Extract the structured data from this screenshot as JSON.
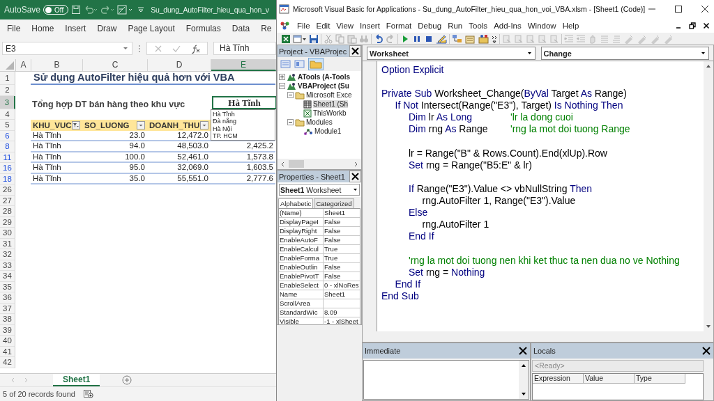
{
  "excel": {
    "autosave": {
      "label": "AutoSave",
      "state": "Off",
      "on": false
    },
    "title": "Su_dung_AutoFilter_hieu_qua_hon_v",
    "ribbon_tabs": [
      "File",
      "Home",
      "Insert",
      "Draw",
      "Page Layout",
      "Formulas",
      "Data",
      "Re"
    ],
    "name_box": "E3",
    "formula": "Hà Tĩnh",
    "columns": [
      {
        "label": "A",
        "selected": false
      },
      {
        "label": "B",
        "selected": false
      },
      {
        "label": "C",
        "selected": false
      },
      {
        "label": "D",
        "selected": false
      },
      {
        "label": "E",
        "selected": true
      }
    ],
    "rows": [
      {
        "number": "1",
        "filtered": false,
        "selected": false,
        "kind": "title",
        "text": "Sử dụng AutoFilter hiệu quả hơn với VBA"
      },
      {
        "number": "2",
        "filtered": false,
        "selected": false,
        "kind": "blank"
      },
      {
        "number": "3",
        "filtered": false,
        "selected": true,
        "kind": "subtitle",
        "text": "Tổng hợp DT bán hàng theo khu vực",
        "cell": "Hà Tĩnh"
      },
      {
        "number": "4",
        "filtered": false,
        "selected": false,
        "kind": "blank"
      },
      {
        "number": "5",
        "filtered": false,
        "selected": false,
        "kind": "header",
        "cells": [
          {
            "label": "KHU_VUC",
            "filter_active": true
          },
          {
            "label": "SO_LUONG",
            "filter_active": false
          },
          {
            "label": "DOANH_THU",
            "filter_active": false
          }
        ]
      },
      {
        "number": "6",
        "filtered": true,
        "selected": false,
        "kind": "data",
        "cells": [
          "Hà Tĩnh",
          "23.0",
          "12,472.0"
        ]
      },
      {
        "number": "8",
        "filtered": true,
        "selected": false,
        "kind": "data",
        "cells": [
          "Hà Tĩnh",
          "94.0",
          "48,503.0",
          "2,425.2"
        ]
      },
      {
        "number": "11",
        "filtered": true,
        "selected": false,
        "kind": "data",
        "cells": [
          "Hà Tĩnh",
          "100.0",
          "52,461.0",
          "1,573.8"
        ]
      },
      {
        "number": "16",
        "filtered": true,
        "selected": false,
        "kind": "data",
        "cells": [
          "Hà Tĩnh",
          "95.0",
          "32,069.0",
          "1,603.5"
        ]
      },
      {
        "number": "18",
        "filtered": true,
        "selected": false,
        "kind": "data",
        "cells": [
          "Hà Tĩnh",
          "35.0",
          "55,551.0",
          "2,777.6"
        ]
      },
      {
        "number": "26",
        "filtered": false,
        "selected": false,
        "kind": "blank"
      },
      {
        "number": "27",
        "filtered": false,
        "selected": false,
        "kind": "blank"
      },
      {
        "number": "28",
        "filtered": false,
        "selected": false,
        "kind": "blank"
      },
      {
        "number": "29",
        "filtered": false,
        "selected": false,
        "kind": "blank"
      },
      {
        "number": "30",
        "filtered": false,
        "selected": false,
        "kind": "blank"
      },
      {
        "number": "31",
        "filtered": false,
        "selected": false,
        "kind": "blank"
      },
      {
        "number": "32",
        "filtered": false,
        "selected": false,
        "kind": "blank"
      },
      {
        "number": "33",
        "filtered": false,
        "selected": false,
        "kind": "blank"
      },
      {
        "number": "34",
        "filtered": false,
        "selected": false,
        "kind": "blank"
      },
      {
        "number": "35",
        "filtered": false,
        "selected": false,
        "kind": "blank"
      },
      {
        "number": "36",
        "filtered": false,
        "selected": false,
        "kind": "blank"
      },
      {
        "number": "37",
        "filtered": false,
        "selected": false,
        "kind": "blank"
      },
      {
        "number": "38",
        "filtered": false,
        "selected": false,
        "kind": "blank"
      },
      {
        "number": "39",
        "filtered": false,
        "selected": false,
        "kind": "blank"
      },
      {
        "number": "40",
        "filtered": false,
        "selected": false,
        "kind": "blank"
      },
      {
        "number": "41",
        "filtered": false,
        "selected": false,
        "kind": "blank"
      },
      {
        "number": "42",
        "filtered": false,
        "selected": false,
        "kind": "blank"
      }
    ],
    "dropdown_list": [
      "Hà Tĩnh",
      "Đà nẵng",
      "Hà Nội",
      "TP. HCM"
    ],
    "sheet_tabs": [
      {
        "label": "Sheet1",
        "selected": true
      }
    ],
    "status": "5 of 20 records found"
  },
  "vba": {
    "title": "Microsoft Visual Basic for Applications - Su_dung_AutoFilter_hieu_qua_hon_voi_VBA.xlsm - [Sheet1 (Code)]",
    "menu": [
      "File",
      "Edit",
      "View",
      "Insert",
      "Format",
      "Debug",
      "Run",
      "Tools",
      "Add-Ins",
      "Window",
      "Help"
    ],
    "project": {
      "title": "Project - VBAProjec",
      "tree": [
        {
          "label": "ATools (A-Tools",
          "kind": "project",
          "expanded": false,
          "selected": false
        },
        {
          "label": "VBAProject (Su",
          "kind": "project",
          "expanded": true,
          "selected": false,
          "children": [
            {
              "label": "Microsoft Exce",
              "kind": "folder",
              "expanded": true,
              "selected": false,
              "children": [
                {
                  "label": "Sheet1 (Sh",
                  "kind": "sheet",
                  "selected": true
                },
                {
                  "label": "ThisWorkb",
                  "kind": "workbook",
                  "selected": false
                }
              ]
            },
            {
              "label": "Modules",
              "kind": "folder",
              "expanded": true,
              "selected": false,
              "children": [
                {
                  "label": "Module1",
                  "kind": "module",
                  "selected": false
                }
              ]
            }
          ]
        }
      ]
    },
    "properties": {
      "title": "Properties - Sheet1",
      "object": "Sheet1",
      "object_type": "Worksheet",
      "tabs": [
        {
          "label": "Alphabetic",
          "selected": true
        },
        {
          "label": "Categorized",
          "selected": false
        }
      ],
      "rows": [
        {
          "name": "(Name)",
          "value": "Sheet1"
        },
        {
          "name": "DisplayPageI",
          "value": "False"
        },
        {
          "name": "DisplayRight",
          "value": "False"
        },
        {
          "name": "EnableAutoF",
          "value": "False"
        },
        {
          "name": "EnableCalcul",
          "value": "True"
        },
        {
          "name": "EnableForma",
          "value": "True"
        },
        {
          "name": "EnableOutlin",
          "value": "False"
        },
        {
          "name": "EnablePivotT",
          "value": "False"
        },
        {
          "name": "EnableSelect",
          "value": "0 - xlNoRes"
        },
        {
          "name": "Name",
          "value": "Sheet1"
        },
        {
          "name": "ScrollArea"
        },
        {
          "name": "StandardWic",
          "value": "8.09"
        },
        {
          "name": "Visible",
          "value": "-1 - xlSheet"
        }
      ]
    },
    "code": {
      "object": "Worksheet",
      "procedure": "Change",
      "lines": [
        {
          "kind": "code",
          "tokens": [
            {
              "kind": "keyword",
              "text": "Option Explicit"
            }
          ]
        },
        {
          "kind": "blank"
        },
        {
          "kind": "code",
          "tokens": [
            {
              "kind": "keyword",
              "text": "Private Sub"
            },
            {
              "kind": "plain",
              "text": " Worksheet_Change("
            },
            {
              "kind": "keyword",
              "text": "ByVal"
            },
            {
              "kind": "plain",
              "text": " Target "
            },
            {
              "kind": "keyword",
              "text": "As"
            },
            {
              "kind": "plain",
              "text": " Range)"
            }
          ],
          "children": [
            {
              "kind": "code",
              "tokens": [
                {
                  "kind": "keyword",
                  "text": "If Not"
                },
                {
                  "kind": "plain",
                  "text": " Intersect(Range(\"E3\"), Target) "
                },
                {
                  "kind": "keyword",
                  "text": "Is Nothing Then"
                }
              ],
              "children": [
                {
                  "kind": "code",
                  "tokens": [
                    {
                      "kind": "keyword",
                      "text": "Dim"
                    },
                    {
                      "kind": "plain",
                      "text": " lr "
                    },
                    {
                      "kind": "keyword",
                      "text": "As Long"
                    },
                    {
                      "kind": "comment",
                      "text": "'lr la dong cuoi"
                    }
                  ]
                },
                {
                  "kind": "code",
                  "tokens": [
                    {
                      "kind": "keyword",
                      "text": "Dim"
                    },
                    {
                      "kind": "plain",
                      "text": " rng "
                    },
                    {
                      "kind": "keyword",
                      "text": "As"
                    },
                    {
                      "kind": "plain",
                      "text": " Range"
                    },
                    {
                      "kind": "comment",
                      "text": "'rng la mot doi tuong Range"
                    }
                  ]
                },
                {
                  "kind": "blank"
                },
                {
                  "kind": "code",
                  "tokens": [
                    {
                      "kind": "plain",
                      "text": "lr = Range(\"B\" & Rows.Count).End(xlUp).Row"
                    }
                  ]
                },
                {
                  "kind": "code",
                  "tokens": [
                    {
                      "kind": "keyword",
                      "text": "Set"
                    },
                    {
                      "kind": "plain",
                      "text": " rng = Range(\"B5:E\" & lr)"
                    }
                  ]
                },
                {
                  "kind": "blank"
                },
                {
                  "kind": "code",
                  "tokens": [
                    {
                      "kind": "keyword",
                      "text": "If"
                    },
                    {
                      "kind": "plain",
                      "text": " Range(\"E3\").Value <> vbNullString "
                    },
                    {
                      "kind": "keyword",
                      "text": "Then"
                    }
                  ],
                  "children": [
                    {
                      "kind": "code",
                      "tokens": [
                        {
                          "kind": "plain",
                          "text": "rng.AutoFilter 1, Range(\"E3\").Value"
                        }
                      ]
                    }
                  ]
                },
                {
                  "kind": "code",
                  "tokens": [
                    {
                      "kind": "keyword",
                      "text": "Else"
                    }
                  ],
                  "children": [
                    {
                      "kind": "code",
                      "tokens": [
                        {
                          "kind": "plain",
                          "text": "rng.AutoFilter 1"
                        }
                      ]
                    }
                  ]
                },
                {
                  "kind": "code",
                  "tokens": [
                    {
                      "kind": "keyword",
                      "text": "End If"
                    }
                  ]
                },
                {
                  "kind": "blank"
                },
                {
                  "kind": "code",
                  "tokens": [
                    {
                      "kind": "comment",
                      "text": "'rng la mot doi tuong nen khi ket thuc ta nen dua no ve Nothing"
                    }
                  ]
                },
                {
                  "kind": "code",
                  "tokens": [
                    {
                      "kind": "keyword",
                      "text": "Set"
                    },
                    {
                      "kind": "plain",
                      "text": " rng = "
                    },
                    {
                      "kind": "keyword",
                      "text": "Nothing"
                    }
                  ]
                }
              ]
            },
            {
              "kind": "code",
              "tokens": [
                {
                  "kind": "keyword",
                  "text": "End If"
                }
              ]
            }
          ]
        },
        {
          "kind": "code",
          "tokens": [
            {
              "kind": "keyword",
              "text": "End Sub"
            }
          ]
        }
      ]
    },
    "immediate": {
      "title": "Immediate"
    },
    "locals": {
      "title": "Locals",
      "status": "<Ready>",
      "columns": [
        "Expression",
        "Value",
        "Type"
      ]
    }
  }
}
